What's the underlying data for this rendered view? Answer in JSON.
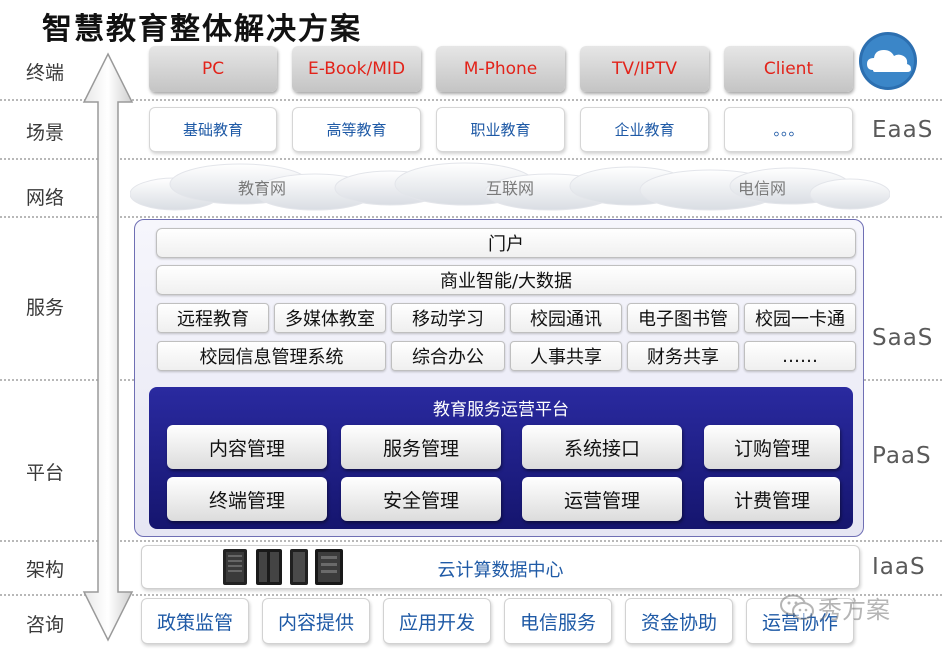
{
  "title": "智慧教育整体解决方案",
  "rows": {
    "terminal": "终端",
    "scenario": "场景",
    "network": "网络",
    "service": "服务",
    "platform": "平台",
    "architecture": "架构",
    "consulting": "咨询"
  },
  "layers": {
    "eaas": "EaaS",
    "saas": "SaaS",
    "paas": "PaaS",
    "iaas": "IaaS"
  },
  "terminals": [
    "PC",
    "E-Book/MID",
    "M-Phone",
    "TV/IPTV",
    "Client"
  ],
  "scenarios": [
    "基础教育",
    "高等教育",
    "职业教育",
    "企业教育",
    "。。。"
  ],
  "networks": [
    "教育网",
    "互联网",
    "电信网"
  ],
  "services": {
    "portal": "门户",
    "bi": "商业智能/大数据",
    "row1": [
      "远程教育",
      "多媒体教室",
      "移动学习",
      "校园通讯",
      "电子图书管",
      "校园一卡通"
    ],
    "row2": [
      "校园信息管理系统",
      "综合办公",
      "人事共享",
      "财务共享",
      "……"
    ]
  },
  "platform": {
    "title": "教育服务运营平台",
    "row1": [
      "内容管理",
      "服务管理",
      "系统接口",
      "订购管理"
    ],
    "row2": [
      "终端管理",
      "安全管理",
      "运营管理",
      "计费管理"
    ]
  },
  "infrastructure": {
    "label": "云计算数据中心"
  },
  "consulting": [
    "政策监管",
    "内容提供",
    "应用开发",
    "电信服务",
    "资金协助",
    "运营协作"
  ],
  "watermark": "秀方案",
  "icons": {
    "cloud": "cloud-icon",
    "server": "server-rack-icon",
    "arrow": "double-arrow-icon",
    "wechat": "wechat-icon"
  },
  "colors": {
    "terminal_text": "#e2231a",
    "link_blue": "#1f5aa6",
    "platform_blue": "#1d1d86"
  }
}
